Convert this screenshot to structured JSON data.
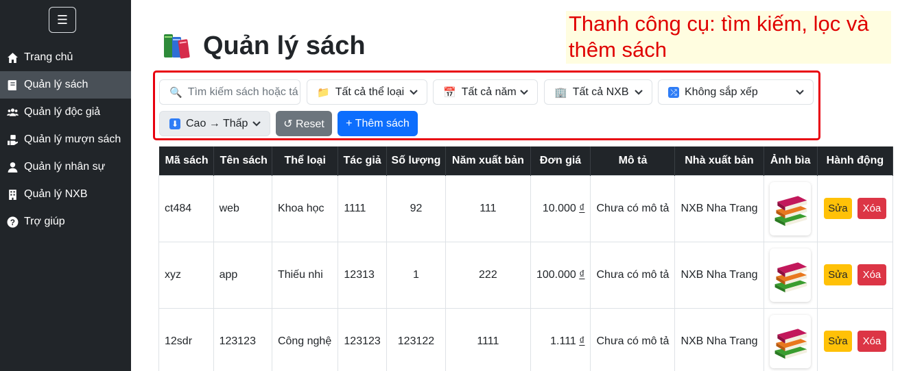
{
  "sidebar": {
    "toggle": "☰",
    "items": [
      {
        "label": "Trang chủ",
        "icon": "home-icon"
      },
      {
        "label": "Quản lý sách",
        "icon": "book-icon"
      },
      {
        "label": "Quản lý độc giả",
        "icon": "users-icon"
      },
      {
        "label": "Quản lý mượn sách",
        "icon": "hand-book-icon"
      },
      {
        "label": "Quản lý nhân sự",
        "icon": "user-icon"
      },
      {
        "label": "Quản lý NXB",
        "icon": "building-icon"
      },
      {
        "label": "Trợ giúp",
        "icon": "help-icon"
      }
    ],
    "active_index": 1
  },
  "header": {
    "title": "Quản lý sách",
    "icon": "books-icon"
  },
  "callout": {
    "text": "Thanh công cụ: tìm kiếm, lọc và thêm sách"
  },
  "toolbar": {
    "search_placeholder": "Tìm kiếm sách hoặc tá",
    "category_filter": "Tất cả thể loại",
    "year_filter": "Tất cả năm",
    "publisher_filter": "Tất cả NXB",
    "sort_select": "Không sắp xếp",
    "order_select": "Cao → Thấp",
    "reset_label": "↺ Reset",
    "add_label": "+ Thêm sách"
  },
  "table": {
    "columns": [
      "Mã sách",
      "Tên sách",
      "Thể loại",
      "Tác giả",
      "Số lượng",
      "Năm xuất bản",
      "Đơn giá",
      "Mô tả",
      "Nhà xuất bản",
      "Ảnh bìa",
      "Hành động"
    ],
    "rows": [
      {
        "id": "ct484",
        "name": "web",
        "category": "Khoa học",
        "author": "1111",
        "qty": "92",
        "year": "111",
        "price": "10.000",
        "currency": "₫",
        "desc": "Chưa có mô tả",
        "publisher": "NXB Nha Trang"
      },
      {
        "id": "xyz",
        "name": "app",
        "category": "Thiếu nhi",
        "author": "12313",
        "qty": "1",
        "year": "222",
        "price": "100.000",
        "currency": "₫",
        "desc": "Chưa có mô tả",
        "publisher": "NXB Nha Trang"
      },
      {
        "id": "12sdr",
        "name": "123123",
        "category": "Công nghệ",
        "author": "123123",
        "qty": "123122",
        "year": "1111",
        "price": "1.111",
        "currency": "₫",
        "desc": "Chưa có mô tả",
        "publisher": "NXB Nha Trang"
      }
    ],
    "edit_label": "Sửa",
    "delete_label": "Xóa"
  }
}
